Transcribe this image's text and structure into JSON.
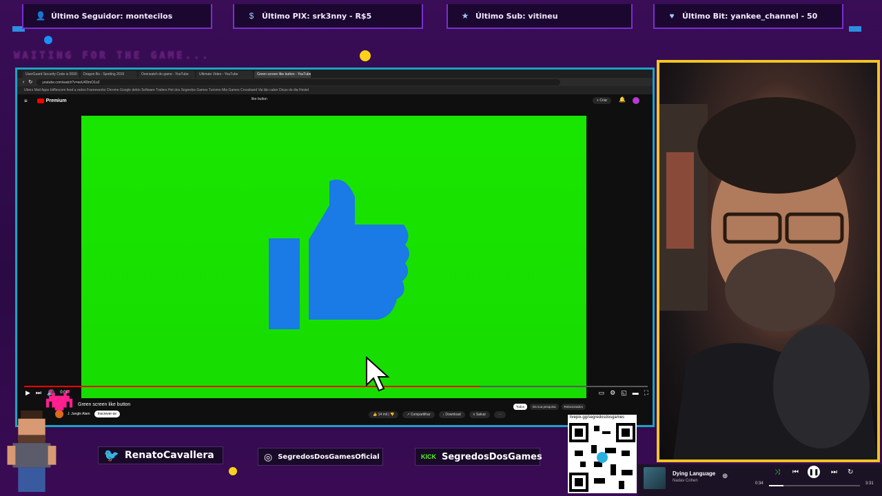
{
  "alerts": {
    "follower": "Último Seguidor: montecilos",
    "pix": "Último PIX: srk3nny - R$5",
    "sub": "Último Sub: vitineu",
    "bit": "Último Bit: yankee_channel - 50"
  },
  "waiting_text": "WAITING FOR THE GAME...",
  "browser": {
    "tabs": [
      "UserGuard Security Code is 0000",
      "Dragon Bo - Spotting 2019",
      "Overwatch do game - YouTube",
      "Ultimate Video - YouTube",
      "Green screen like button - YouTube"
    ],
    "active_tab_index": 4,
    "url": "youtube.com/watch?v=eeU4DmO1oZ",
    "bookmarks": "Uberz   Mail   Apps   bitflexcom   feed a redes   Frameworks   Chrome   Google dekto   Software   Trailers   Hot dos   Segredos Games   Turismo   Mia Games   Crossband   Vai tão caber   Dicas do dia   Hostel"
  },
  "youtube": {
    "logo_label": "Premium",
    "search_value": "like button",
    "create_label": "Criar",
    "video_title": "Green screen like button",
    "channel_name": "J. Jungle Alam",
    "subscribe_label": "Inscrever-se",
    "likes": "14 mil",
    "share_label": "Compartilhar",
    "download_label": "Download",
    "save_label": "Salvar",
    "chips": [
      "Todos",
      "Da sua pesquisa",
      "Relacionados"
    ],
    "time_label": "0:00",
    "progress": 0.73
  },
  "socials": {
    "twitter": "RenatoCavallera",
    "instagram": "SegredosDosGamesOficial",
    "kick": "SegredosDosGames",
    "kick_badge": "KICK"
  },
  "qr_url": "livepix.gg/segredosdosgames",
  "player": {
    "song": "Dying Language",
    "artist": "Nadav Cohen",
    "elapsed": "0:34",
    "total": "3:31",
    "progress": 0.16
  },
  "colors": {
    "frame_border": "#1aa3c8",
    "cam_border": "#f3c51f",
    "green_screen": "#18e600",
    "like_blue": "#1a7ae6"
  }
}
